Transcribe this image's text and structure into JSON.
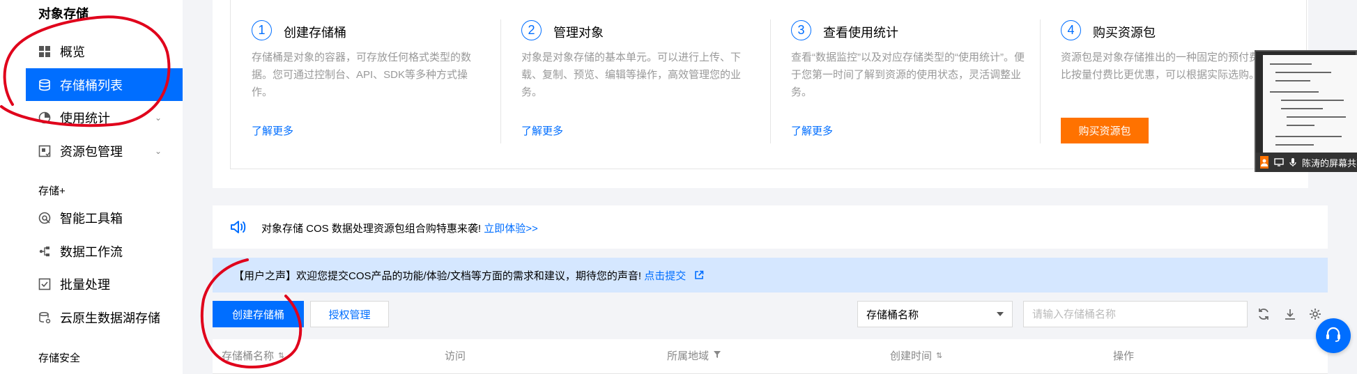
{
  "colors": {
    "accent": "#006eff",
    "buy": "#ff7200",
    "notice_bg": "#d5e7ff",
    "annotation": "#e0001b"
  },
  "sidebar": {
    "title": "对象存储",
    "items": [
      {
        "label": "概览",
        "icon": "grid-icon"
      },
      {
        "label": "存储桶列表",
        "icon": "bucket-icon",
        "active": true
      },
      {
        "label": "使用统计",
        "icon": "pie-chart-icon"
      },
      {
        "label": "资源包管理",
        "icon": "package-icon"
      }
    ],
    "section_storage_plus": "存储+",
    "plus_items": [
      {
        "label": "智能工具箱",
        "icon": "toolbox-icon"
      },
      {
        "label": "数据工作流",
        "icon": "workflow-icon"
      },
      {
        "label": "批量处理",
        "icon": "batch-icon"
      },
      {
        "label": "云原生数据湖存储",
        "icon": "datalake-icon"
      }
    ],
    "section_security": "存储安全"
  },
  "steps": [
    {
      "num": "1",
      "title": "创建存储桶",
      "desc": "存储桶是对象的容器，可存放任何格式类型的数据。您可通过控制台、API、SDK等多种方式操作。",
      "link": "了解更多"
    },
    {
      "num": "2",
      "title": "管理对象",
      "desc": "对象是对象存储的基本单元。可以进行上传、下载、复制、预览、编辑等操作，高效管理您的业务。",
      "link": "了解更多"
    },
    {
      "num": "3",
      "title": "查看使用统计",
      "desc": "查看“数据监控”以及对应存储类型的“使用统计”。便于您第一时间了解到资源的使用状态，灵活调整业务。",
      "link": "了解更多"
    },
    {
      "num": "4",
      "title": "购买资源包",
      "desc": "资源包是对象存储推出的一种固定的预付费套餐，比按量付费比更优惠，可以根据实际选购。",
      "button": "购买资源包"
    }
  ],
  "promo": {
    "text": "对象存储 COS 数据处理资源包组合购特惠来袭!",
    "link": "立即体验>>"
  },
  "notice": {
    "text": "【用户之声】欢迎您提交COS产品的功能/体验/文档等方面的需求和建议，期待您的声音!",
    "link": "点击提交"
  },
  "toolbar": {
    "create_label": "创建存储桶",
    "auth_label": "授权管理",
    "filter_select": "存储桶名称",
    "search_placeholder": "请输入存储桶名称"
  },
  "table": {
    "columns": [
      "存储桶名称",
      "访问",
      "所属地域",
      "创建时间",
      "操作"
    ]
  },
  "share": {
    "label": "陈涛的屏幕共享"
  }
}
